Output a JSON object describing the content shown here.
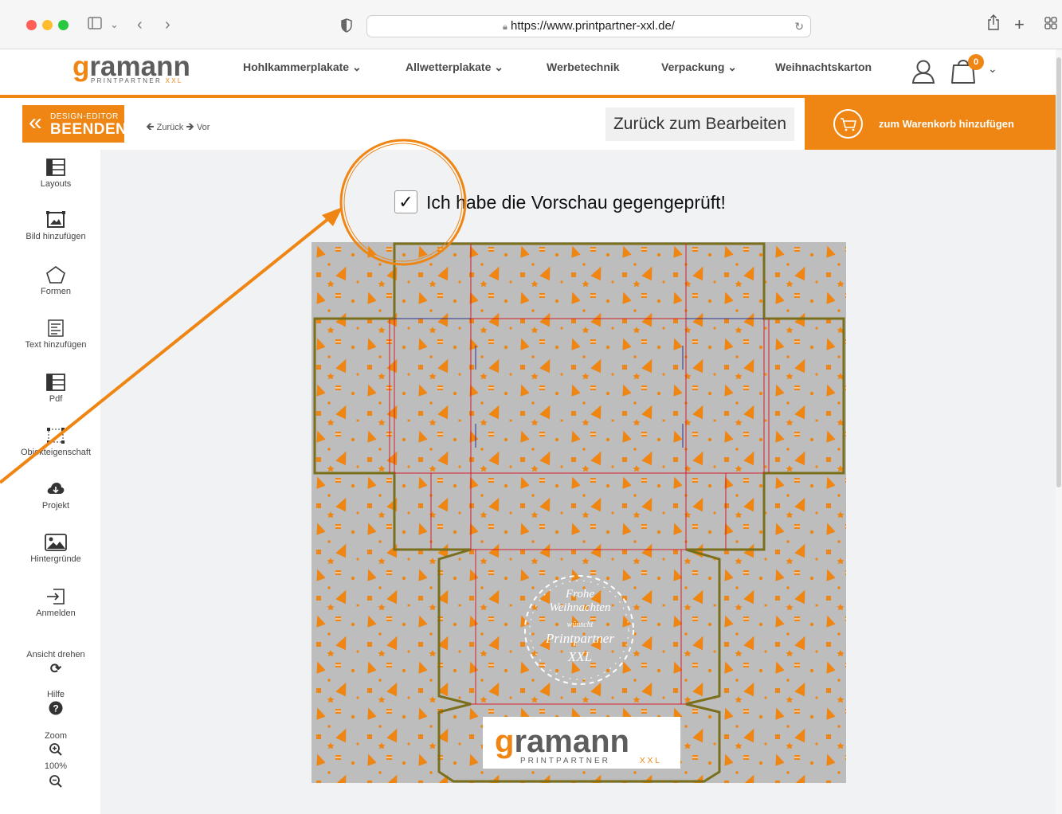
{
  "browser": {
    "url": "https://www.printpartner-xxl.de/"
  },
  "site": {
    "logo_main": "gramann",
    "logo_sub": "PRINTPARTNER",
    "logo_xxl": "XXL",
    "nav": [
      {
        "label": "Hohlkammerplakate",
        "dropdown": true
      },
      {
        "label": "Allwetterplakate",
        "dropdown": true
      },
      {
        "label": "Werbetechnik",
        "dropdown": false
      },
      {
        "label": "Verpackung",
        "dropdown": true
      },
      {
        "label": "Weihnachtskarton",
        "dropdown": false
      }
    ],
    "cart_count": "0",
    "accent_color": "#ef8512"
  },
  "editor": {
    "exit_line1": "DESIGN-EDITOR",
    "exit_line2": "BEENDEN",
    "undo_label": "Zurück",
    "redo_label": "Vor",
    "back_to_edit": "Zurück zum Bearbeiten",
    "add_to_cart": "zum Warenkorb hinzufügen",
    "confirm_label": "Ich habe die Vorschau gegengeprüft!",
    "confirm_checked": true,
    "confirm_check_glyph": "✓"
  },
  "sidebar": {
    "tools": [
      {
        "label": "Layouts",
        "icon": "layout-icon"
      },
      {
        "label": "Bild hinzufügen",
        "icon": "image-add-icon"
      },
      {
        "label": "Formen",
        "icon": "shapes-icon"
      },
      {
        "label": "Text hinzufügen",
        "icon": "text-icon"
      },
      {
        "label": "Pdf",
        "icon": "pdf-icon"
      },
      {
        "label": "Objekteigenschaft",
        "icon": "object-properties-icon"
      },
      {
        "label": "Projekt",
        "icon": "cloud-icon"
      },
      {
        "label": "Hintergründe",
        "icon": "background-icon"
      },
      {
        "label": "Anmelden",
        "icon": "login-icon"
      },
      {
        "label": "Ansicht drehen",
        "icon": "rotate-icon"
      },
      {
        "label": "Hilfe",
        "icon": "help-icon"
      },
      {
        "label": "Zoom",
        "icon": "zoom-in-icon"
      }
    ],
    "zoom_value": "100%"
  },
  "preview": {
    "greeting_line1": "Frohe",
    "greeting_line2": "Weihnachten",
    "greeting_line3": "wünscht",
    "greeting_line4": "Printpartner",
    "greeting_line5": "XXL",
    "bottom_logo_main": "gramann",
    "bottom_logo_sub": "PRINTPARTNER",
    "bottom_logo_xxl": "XXL"
  }
}
